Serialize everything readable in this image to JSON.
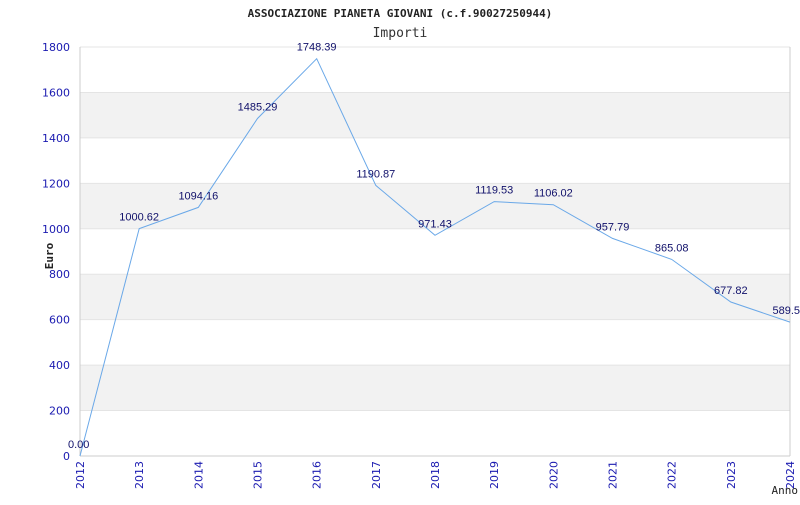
{
  "chart_data": {
    "type": "line",
    "title": "ASSOCIAZIONE PIANETA GIOVANI (c.f.90027250944)",
    "subtitle": "Importi",
    "xlabel": "Anno",
    "ylabel": "Euro",
    "ylim": [
      0,
      1800
    ],
    "yticks": [
      0,
      200,
      400,
      600,
      800,
      1000,
      1200,
      1400,
      1600,
      1800
    ],
    "grid": true,
    "categories": [
      "2012",
      "2013",
      "2014",
      "2015",
      "2016",
      "2017",
      "2018",
      "2019",
      "2020",
      "2021",
      "2022",
      "2023",
      "2024"
    ],
    "series": [
      {
        "values": [
          0,
          1000.62,
          1094.16,
          1485.29,
          1748.39,
          1190.87,
          971.43,
          1119.53,
          1106.02,
          957.79,
          865.08,
          677.82,
          589.5
        ],
        "labels": [
          "0.00",
          "1000.62",
          "1094.16",
          "1485.29",
          "1748.39",
          "1190.87",
          "971.43",
          "1119.53",
          "1106.02",
          "957.79",
          "865.08",
          "677.82",
          "589.5"
        ]
      }
    ],
    "colors": {
      "line": "#6aa8e8",
      "band": "#f2f2f2",
      "axis": "#cccccc",
      "tick_text": "#1a1ab0",
      "data_label": "#10106a"
    }
  }
}
